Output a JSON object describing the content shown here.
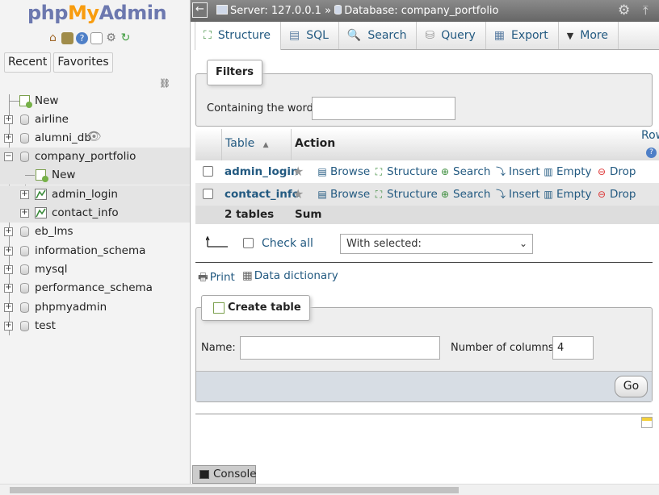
{
  "logo": {
    "php": "php",
    "my": "My",
    "admin": "Admin"
  },
  "nav": {
    "tabs": [
      "Recent",
      "Favorites"
    ],
    "tree": [
      {
        "label": "New"
      },
      {
        "label": "airline"
      },
      {
        "label": "alumni_db"
      },
      {
        "label": "company_portfolio"
      },
      {
        "label": "New"
      },
      {
        "label": "admin_login"
      },
      {
        "label": "contact_info"
      },
      {
        "label": "eb_lms"
      },
      {
        "label": "information_schema"
      },
      {
        "label": "mysql"
      },
      {
        "label": "performance_schema"
      },
      {
        "label": "phpmyadmin"
      },
      {
        "label": "test"
      }
    ]
  },
  "topbar": {
    "server": "Server: 127.0.0.1",
    "sep": "»",
    "database": "Database: company_portfolio"
  },
  "tabs": [
    "Structure",
    "SQL",
    "Search",
    "Query",
    "Export",
    "More"
  ],
  "filters": {
    "legend": "Filters",
    "label": "Containing the word:"
  },
  "table": {
    "headers": {
      "table": "Table",
      "action": "Action",
      "rows_clipped": "Row"
    },
    "actions": [
      "Browse",
      "Structure",
      "Search",
      "Insert",
      "Empty",
      "Drop"
    ],
    "rows": [
      {
        "name": "admin_login"
      },
      {
        "name": "contact_info"
      }
    ],
    "summary": {
      "count": "2 tables",
      "sum": "Sum"
    }
  },
  "checkall": {
    "label": "Check all",
    "with_selected": "With selected:"
  },
  "links": {
    "print": "Print",
    "dictionary": "Data dictionary"
  },
  "create": {
    "legend": "Create table",
    "name_label": "Name:",
    "cols_label": "Number of columns:",
    "cols_value": "4",
    "go": "Go"
  },
  "console": {
    "label": "Console"
  },
  "colors": {
    "link": "#235a81",
    "logo_blue": "#6c78af",
    "logo_orange": "#f89c0e",
    "topbar": "#777777",
    "selected_row": "#e4e4e4"
  },
  "icons": [
    "home-icon",
    "logout-icon",
    "help-icon",
    "docs-icon",
    "settings-icon",
    "reload-icon",
    "link-icon",
    "database-icon",
    "table-icon",
    "favorite-star-icon",
    "browse-icon",
    "structure-icon",
    "search-icon",
    "insert-icon",
    "empty-icon",
    "drop-icon",
    "print-icon",
    "data-dictionary-icon",
    "create-table-icon",
    "gear-icon",
    "collapse-icon",
    "console-icon"
  ]
}
